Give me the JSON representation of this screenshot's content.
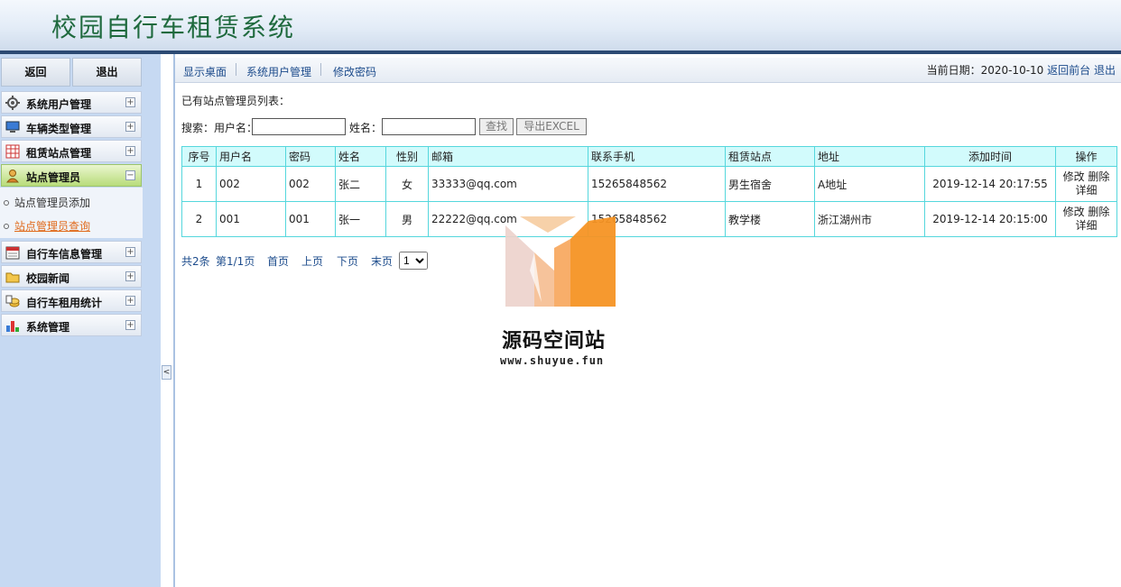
{
  "header": {
    "title": "校园自行车租赁系统"
  },
  "sidebar": {
    "back_label": "返回",
    "logout_label": "退出",
    "menu": [
      {
        "label": "系统用户管理",
        "icon": "gear-icon",
        "toggle": "+"
      },
      {
        "label": "车辆类型管理",
        "icon": "monitor-icon",
        "toggle": "+"
      },
      {
        "label": "租赁站点管理",
        "icon": "grid-icon",
        "toggle": "+"
      },
      {
        "label": "站点管理员",
        "icon": "user-icon",
        "toggle": "−"
      },
      {
        "label": "自行车信息管理",
        "icon": "calendar-icon",
        "toggle": "+"
      },
      {
        "label": "校园新闻",
        "icon": "folder-icon",
        "toggle": "+"
      },
      {
        "label": "自行车租用统计",
        "icon": "coins-icon",
        "toggle": "+"
      },
      {
        "label": "系统管理",
        "icon": "chart-icon",
        "toggle": "+"
      }
    ],
    "submenu": [
      {
        "label": "站点管理员添加"
      },
      {
        "label": "站点管理员查询"
      }
    ],
    "collapse_glyph": "<"
  },
  "topnav": {
    "links": [
      "显示桌面",
      "系统用户管理",
      "修改密码"
    ],
    "date_label": "当前日期：2020-10-10",
    "back_front": "返回前台",
    "logout": "退出"
  },
  "main": {
    "list_title": "已有站点管理员列表：",
    "search": {
      "username_label": "搜索：用户名：",
      "name_label": "姓名：",
      "search_btn": "查找",
      "export_btn": "导出EXCEL"
    },
    "table": {
      "headers": [
        "序号",
        "用户名",
        "密码",
        "姓名",
        "性别",
        "邮箱",
        "联系手机",
        "租赁站点",
        "地址",
        "添加时间",
        "操作"
      ],
      "rows": [
        [
          "1",
          "002",
          "002",
          "张二",
          "女",
          "33333@qq.com",
          "15265848562",
          "男生宿舍",
          "A地址",
          "2019-12-14 20:17:55",
          "修改 删除",
          "详细"
        ],
        [
          "2",
          "001",
          "001",
          "张一",
          "男",
          "22222@qq.com",
          "15265848562",
          "教学楼",
          "浙江湖州市",
          "2019-12-14 20:15:00",
          "修改 删除",
          "详细"
        ]
      ]
    },
    "pager": {
      "total": "共2条",
      "page": "第1/1页",
      "first": "首页",
      "prev": "上页",
      "next": "下页",
      "last": "末页",
      "select_value": "1"
    }
  },
  "watermark": {
    "name": "源码空间站",
    "url": "www.shuyue.fun"
  },
  "colors": {
    "title_green": "#1f6a3e",
    "link_blue": "#1d4c8c",
    "table_border": "#55d7dd",
    "header_cell": "#d2fbfc",
    "active_sub": "#e06a1b"
  }
}
